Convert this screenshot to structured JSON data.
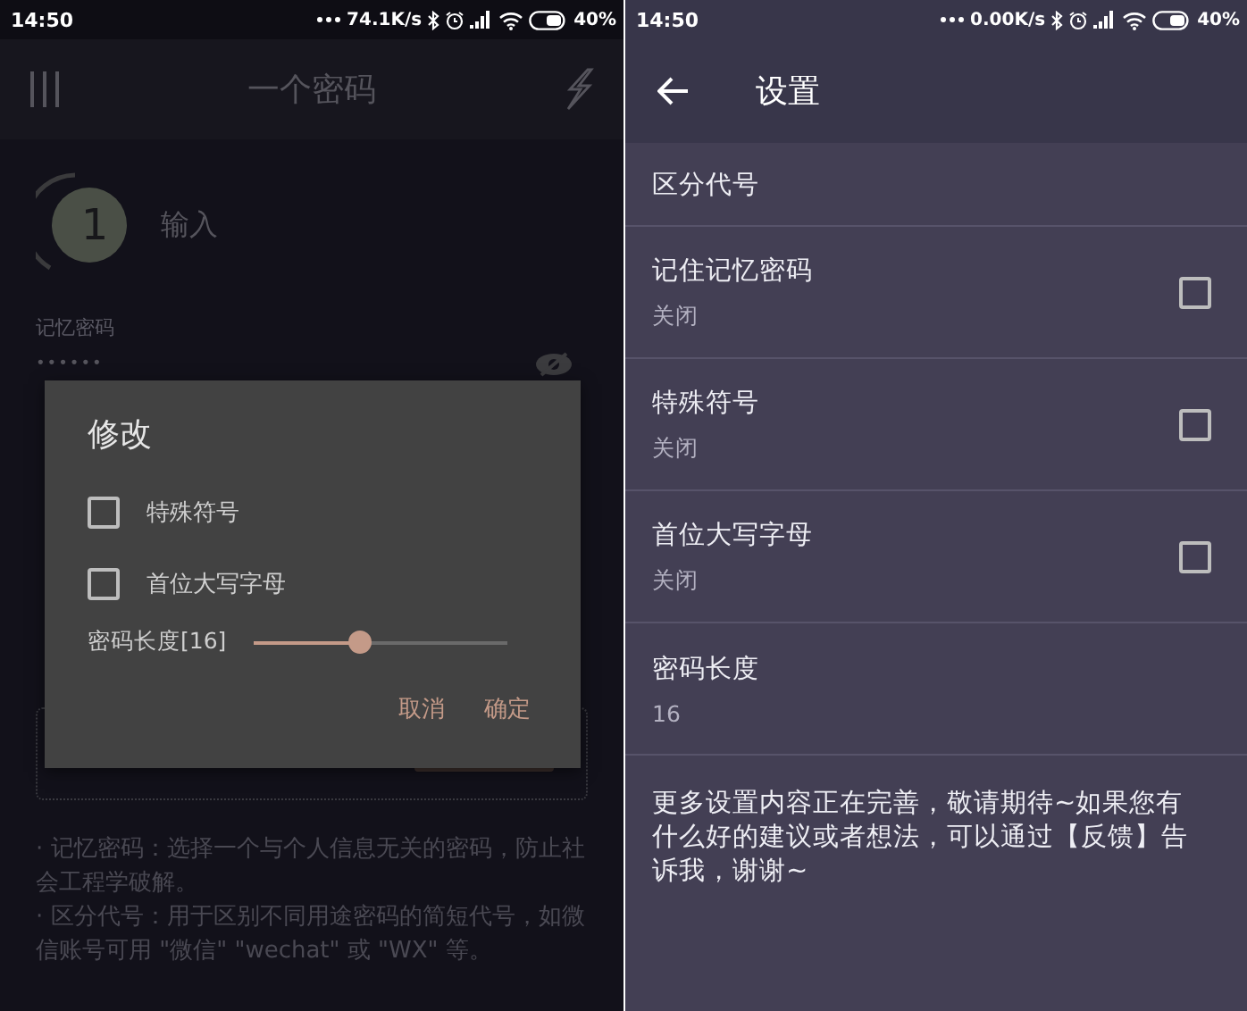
{
  "left_screen": {
    "status_bar": {
      "time": "14:50",
      "speed": "74.1K/s",
      "battery": "40%"
    },
    "app_bar": {
      "title": "一个密码"
    },
    "step": {
      "number": "1",
      "label": "输入"
    },
    "memory_field": {
      "label": "记忆密码",
      "value": "••••••"
    },
    "notes": [
      "· 记忆密码：选择一个与个人信息无关的密码，防止社会工程学破解。",
      "· 区分代号：用于区别不同用途密码的简短代号，如微信账号可用 \"微信\" \"wechat\" 或 \"WX\" 等。"
    ],
    "dialog": {
      "title": "修改",
      "options": [
        {
          "label": "特殊符号",
          "checked": false
        },
        {
          "label": "首位大写字母",
          "checked": false
        }
      ],
      "slider": {
        "label": "密码长度[16]",
        "level": 0.38
      },
      "buttons": [
        "取消",
        "确定"
      ]
    }
  },
  "right_screen": {
    "status_bar": {
      "time": "14:50",
      "speed": "0.00K/s",
      "battery": "40%"
    },
    "app_bar": {
      "title": "设置"
    },
    "settings": [
      {
        "kind": "header",
        "title": "区分代号"
      },
      {
        "kind": "toggle",
        "title": "记住记忆密码",
        "summary": "关闭",
        "checked": false
      },
      {
        "kind": "toggle",
        "title": "特殊符号",
        "summary": "关闭",
        "checked": false
      },
      {
        "kind": "toggle",
        "title": "首位大写字母",
        "summary": "关闭",
        "checked": false
      },
      {
        "kind": "value",
        "title": "密码长度",
        "summary": "16"
      }
    ],
    "footer": "更多设置内容正在完善，敬请期待~如果您有什么好的建议或者想法，可以通过【反馈】告诉我，谢谢~"
  }
}
